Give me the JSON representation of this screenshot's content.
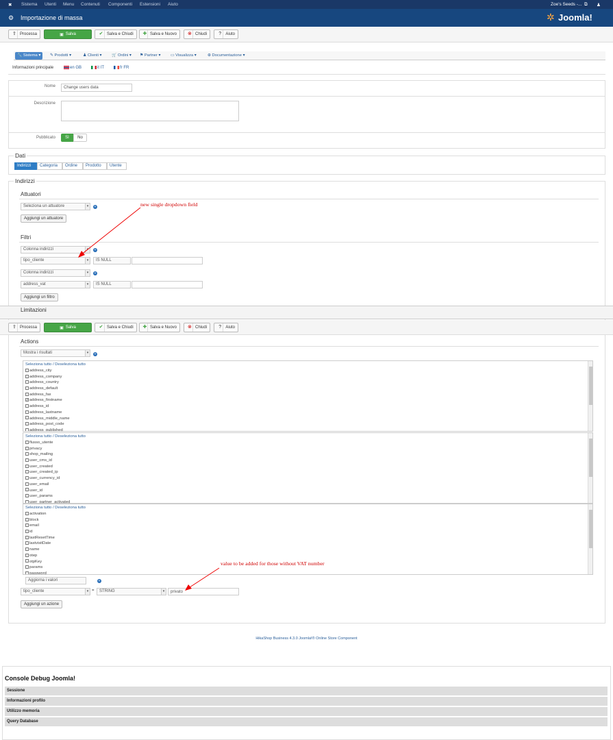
{
  "topbar": {
    "menu": [
      "Sistema",
      "Utenti",
      "Menu",
      "Contenuti",
      "Componenti",
      "Estensioni",
      "Aiuto"
    ],
    "site": "Zoe's Seeds -..."
  },
  "title": "Importazione di massa",
  "brand": "Joomla!",
  "toolbar": {
    "process": "Processa",
    "save": "Salva",
    "save_close": "Salva e Chiudi",
    "save_new": "Salva e Nuovo",
    "close": "Chiudi",
    "help": "Aiuto"
  },
  "menu_tabs": [
    "Sistema",
    "Prodotti",
    "Clienti",
    "Ordini",
    "Partner",
    "Visualizza",
    "Documentazione"
  ],
  "lang_label": "Informazioni principale",
  "langs": [
    "en GB",
    "it IT",
    "fr FR"
  ],
  "form": {
    "name_label": "Nome",
    "name_value": "Change users data",
    "desc_label": "Descrizione",
    "published_label": "Pubblicato",
    "yes": "Sì",
    "no": "No"
  },
  "dati": {
    "legend": "Dati",
    "tabs": [
      "Indirizzi",
      "Categoria",
      "Ordine",
      "Prodotto",
      "Utente"
    ]
  },
  "indirizzi_legend": "Indirizzi",
  "attuatori": {
    "legend": "Attuatori",
    "select": "Seleziona un attuatore",
    "add": "Aggiungi un attuatore"
  },
  "filtri": {
    "legend": "Filtri",
    "col1": "Colonna indirizzi",
    "f1_field": "tipo_cliente",
    "f1_op": "IS NULL",
    "col2": "Colonna indirizzi",
    "f2_field": "address_vat",
    "f2_op": "IS NULL",
    "add": "Aggiungi un filtro"
  },
  "limitazioni": "Limitazioni",
  "actions": {
    "legend": "Actions",
    "select": "Mostra i risultati",
    "select_all": "Seleziona tutto / Deseleziona tutto",
    "list1": [
      "address_city",
      "address_company",
      "address_country",
      "address_default",
      "address_fax",
      "address_firstname",
      "address_id",
      "address_lastname",
      "address_middle_name",
      "address_post_code",
      "address_published"
    ],
    "list1_checked": [
      "address_firstname"
    ],
    "list2": [
      "flusso_utente",
      "privacy",
      "shop_mailing",
      "user_cms_id",
      "user_created",
      "user_created_ip",
      "user_currency_id",
      "user_email",
      "user_id",
      "user_params",
      "user_partner_activated"
    ],
    "list3": [
      "activation",
      "block",
      "email",
      "id",
      "lastResetTime",
      "lastvisitDate",
      "name",
      "otep",
      "otpKey",
      "params",
      "password"
    ],
    "update_select": "Aggiorna i valori",
    "field": "tipo_cliente",
    "type": "STRING",
    "value": "privato",
    "add": "Aggiungi un azione"
  },
  "annotations": {
    "a1": "new  single dropdown field",
    "a2": "value to be added for those without VAT number"
  },
  "footer": "HikaShop Business 4.3.0 Joomla!® Online Store Component",
  "debug": {
    "title": "Console Debug Joomla!",
    "items": [
      "Sessione",
      "Informazioni profilo",
      "Utilizzo memoria",
      "Query Database"
    ]
  }
}
